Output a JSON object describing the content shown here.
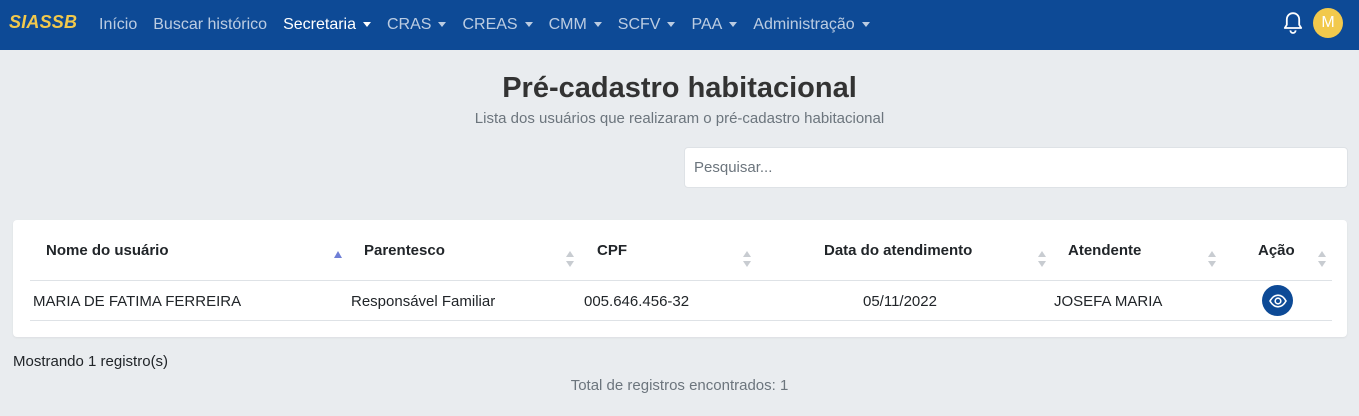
{
  "app": {
    "brand": "SIASSB"
  },
  "nav": {
    "items": [
      {
        "label": "Início",
        "dropdown": false,
        "active": false
      },
      {
        "label": "Buscar histórico",
        "dropdown": false,
        "active": false
      },
      {
        "label": "Secretaria",
        "dropdown": true,
        "active": true
      },
      {
        "label": "CRAS",
        "dropdown": true,
        "active": false
      },
      {
        "label": "CREAS",
        "dropdown": true,
        "active": false
      },
      {
        "label": "CMM",
        "dropdown": true,
        "active": false
      },
      {
        "label": "SCFV",
        "dropdown": true,
        "active": false
      },
      {
        "label": "PAA",
        "dropdown": true,
        "active": false
      },
      {
        "label": "Administração",
        "dropdown": true,
        "active": false
      }
    ],
    "notification_icon": "bell-icon",
    "avatar_initial": "M"
  },
  "header": {
    "title": "Pré-cadastro habitacional",
    "subtitle": "Lista dos usuários que realizaram o pré-cadastro habitacional"
  },
  "search": {
    "placeholder": "Pesquisar...",
    "value": ""
  },
  "table": {
    "columns": [
      {
        "label": "Nome do usuário",
        "sort": "asc"
      },
      {
        "label": "Parentesco",
        "sort": "none"
      },
      {
        "label": "CPF",
        "sort": "none"
      },
      {
        "label": "Data do atendimento",
        "sort": "none"
      },
      {
        "label": "Atendente",
        "sort": "none"
      },
      {
        "label": "Ação",
        "sort": "none"
      }
    ],
    "rows": [
      {
        "nome": "MARIA DE FATIMA FERREIRA",
        "parentesco": "Responsável Familiar",
        "cpf": "005.646.456-32",
        "data": "05/11/2022",
        "atendente": "JOSEFA MARIA",
        "action_icon": "eye-icon"
      }
    ]
  },
  "footer": {
    "showing": "Mostrando 1 registro(s)",
    "total": "Total de registros encontrados: 1"
  },
  "colors": {
    "navbar": "#0d4a96",
    "brand": "#f2c94c",
    "avatar": "#f2c94c",
    "sort_active": "#6f7fd6",
    "sort_inactive": "#c8ccd1"
  }
}
